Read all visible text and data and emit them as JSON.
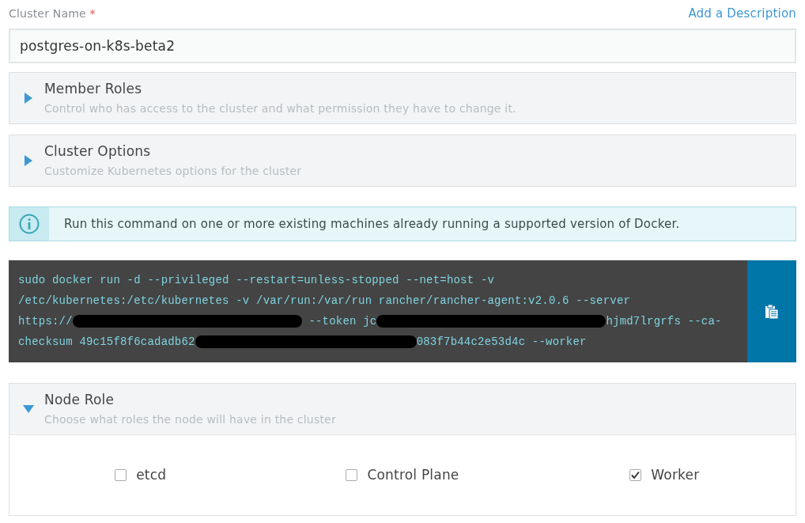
{
  "cluster_name": {
    "label": "Cluster Name",
    "required_mark": "*",
    "value": "postgres-on-k8s-beta2",
    "link": "Add a Description"
  },
  "sections": [
    {
      "title": "Member Roles",
      "subtitle": "Control who has access to the cluster and what permission they have to change it.",
      "expanded": false
    },
    {
      "title": "Cluster Options",
      "subtitle": "Customize Kubernetes options for the cluster",
      "expanded": false
    }
  ],
  "info": {
    "text": "Run this command on one or more existing machines already running a supported version of Docker."
  },
  "command": {
    "lines": [
      [
        {
          "kind": "text",
          "text": "sudo docker run -d --privileged --restart=unless-stopped --net=host -v"
        }
      ],
      [
        {
          "kind": "text",
          "text": "/etc/kubernetes:/etc/kubernetes -v /var/run:/var/run rancher/rancher-agent:v2.0.6 --server"
        }
      ],
      [
        {
          "kind": "text",
          "text": "https://"
        },
        {
          "kind": "redacted"
        },
        {
          "kind": "text",
          "text": " --token jc"
        },
        {
          "kind": "redacted"
        },
        {
          "kind": "text",
          "text": "hjmd7lrgrfs --ca-"
        }
      ],
      [
        {
          "kind": "text",
          "text": "checksum 49c15f8f6cadadb62"
        },
        {
          "kind": "redacted"
        },
        {
          "kind": "text",
          "text": "083f7b44c2e53d4c --worker"
        }
      ]
    ]
  },
  "node_role": {
    "title": "Node Role",
    "subtitle": "Choose what roles the node will have in the cluster",
    "expanded": true,
    "roles": [
      {
        "label": "etcd",
        "checked": false
      },
      {
        "label": "Control Plane",
        "checked": false
      },
      {
        "label": "Worker",
        "checked": true
      }
    ]
  }
}
